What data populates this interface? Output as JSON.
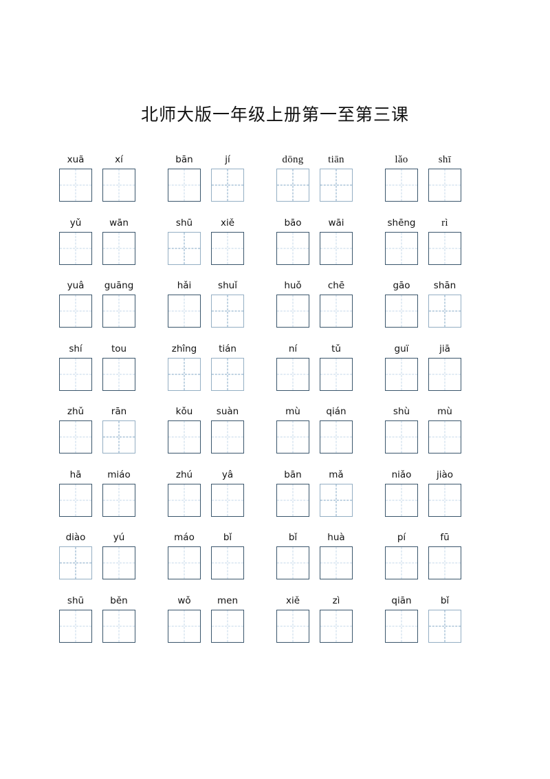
{
  "document": {
    "title": "北师大版一年级上册第一至第三课",
    "page_background": "#ffffff",
    "grid_border_color": "#39556b",
    "grid_guide_color": "#c3d7e8"
  },
  "worksheet": {
    "columns_per_row": 4,
    "cells_per_group": 2,
    "rows": [
      {
        "index": 1,
        "groups": [
          {
            "cells": [
              {
                "pinyin": "xuã",
                "style": "sans"
              },
              {
                "pinyin": "xí",
                "style": "sans"
              }
            ]
          },
          {
            "cells": [
              {
                "pinyin": "bān",
                "style": "sans"
              },
              {
                "pinyin": "jí",
                "style": "sans"
              }
            ]
          },
          {
            "cells": [
              {
                "pinyin": "dōng",
                "style": "serif"
              },
              {
                "pinyin": "tiān",
                "style": "serif"
              }
            ]
          },
          {
            "cells": [
              {
                "pinyin": "lǎo",
                "style": "serif"
              },
              {
                "pinyin": "shī",
                "style": "serif"
              }
            ]
          }
        ]
      },
      {
        "index": 2,
        "groups": [
          {
            "cells": [
              {
                "pinyin": "yǔ",
                "style": "sans"
              },
              {
                "pinyin": "wān",
                "style": "sans"
              }
            ]
          },
          {
            "cells": [
              {
                "pinyin": "shū",
                "style": "sans"
              },
              {
                "pinyin": "xiě",
                "style": "sans"
              }
            ]
          },
          {
            "cells": [
              {
                "pinyin": "bāo",
                "style": "sans"
              },
              {
                "pinyin": "wāi",
                "style": "sans"
              }
            ]
          },
          {
            "cells": [
              {
                "pinyin": "shēng",
                "style": "sans"
              },
              {
                "pinyin": "rì",
                "style": "serif"
              }
            ]
          }
        ]
      },
      {
        "index": 3,
        "groups": [
          {
            "cells": [
              {
                "pinyin": "yuâ",
                "style": "sans"
              },
              {
                "pinyin": "guāng",
                "style": "sans"
              }
            ]
          },
          {
            "cells": [
              {
                "pinyin": "hǎi",
                "style": "sans"
              },
              {
                "pinyin": "shuǐ",
                "style": "sans"
              }
            ]
          },
          {
            "cells": [
              {
                "pinyin": "huǒ",
                "style": "sans"
              },
              {
                "pinyin": "chē",
                "style": "sans"
              }
            ]
          },
          {
            "cells": [
              {
                "pinyin": "gāo",
                "style": "sans"
              },
              {
                "pinyin": "shān",
                "style": "sans"
              }
            ]
          }
        ]
      },
      {
        "index": 4,
        "groups": [
          {
            "cells": [
              {
                "pinyin": "shí",
                "style": "sans"
              },
              {
                "pinyin": "tou",
                "style": "sans"
              }
            ]
          },
          {
            "cells": [
              {
                "pinyin": "zhîng",
                "style": "sans"
              },
              {
                "pinyin": "tián",
                "style": "sans"
              }
            ]
          },
          {
            "cells": [
              {
                "pinyin": "ní",
                "style": "sans"
              },
              {
                "pinyin": "tǔ",
                "style": "sans"
              }
            ]
          },
          {
            "cells": [
              {
                "pinyin": "guï",
                "style": "sans"
              },
              {
                "pinyin": "jiā",
                "style": "sans"
              }
            ]
          }
        ]
      },
      {
        "index": 5,
        "groups": [
          {
            "cells": [
              {
                "pinyin": "zhǔ",
                "style": "sans"
              },
              {
                "pinyin": "rān",
                "style": "sans"
              }
            ]
          },
          {
            "cells": [
              {
                "pinyin": "kǒu",
                "style": "sans"
              },
              {
                "pinyin": "suàn",
                "style": "sans"
              }
            ]
          },
          {
            "cells": [
              {
                "pinyin": "mù",
                "style": "sans"
              },
              {
                "pinyin": "qián",
                "style": "sans"
              }
            ]
          },
          {
            "cells": [
              {
                "pinyin": "shù",
                "style": "sans"
              },
              {
                "pinyin": "mù",
                "style": "sans"
              }
            ]
          }
        ]
      },
      {
        "index": 6,
        "groups": [
          {
            "cells": [
              {
                "pinyin": "hā",
                "style": "sans"
              },
              {
                "pinyin": "miáo",
                "style": "sans"
              }
            ]
          },
          {
            "cells": [
              {
                "pinyin": "zhú",
                "style": "sans"
              },
              {
                "pinyin": "yâ",
                "style": "sans"
              }
            ]
          },
          {
            "cells": [
              {
                "pinyin": "bān",
                "style": "sans"
              },
              {
                "pinyin": "mǎ",
                "style": "sans"
              }
            ]
          },
          {
            "cells": [
              {
                "pinyin": "niǎo",
                "style": "sans"
              },
              {
                "pinyin": "jiào",
                "style": "sans"
              }
            ]
          }
        ]
      },
      {
        "index": 7,
        "groups": [
          {
            "cells": [
              {
                "pinyin": "diào",
                "style": "sans"
              },
              {
                "pinyin": "yú",
                "style": "sans"
              }
            ]
          },
          {
            "cells": [
              {
                "pinyin": "máo",
                "style": "sans"
              },
              {
                "pinyin": "bǐ",
                "style": "sans"
              }
            ]
          },
          {
            "cells": [
              {
                "pinyin": "bǐ",
                "style": "sans"
              },
              {
                "pinyin": "huà",
                "style": "sans"
              }
            ]
          },
          {
            "cells": [
              {
                "pinyin": "pí",
                "style": "sans"
              },
              {
                "pinyin": "fū",
                "style": "sans"
              }
            ]
          }
        ]
      },
      {
        "index": 8,
        "groups": [
          {
            "cells": [
              {
                "pinyin": "shū",
                "style": "sans"
              },
              {
                "pinyin": "běn",
                "style": "sans"
              }
            ]
          },
          {
            "cells": [
              {
                "pinyin": "wǒ",
                "style": "sans"
              },
              {
                "pinyin": "men",
                "style": "sans"
              }
            ]
          },
          {
            "cells": [
              {
                "pinyin": "xiě",
                "style": "sans"
              },
              {
                "pinyin": "zì",
                "style": "sans"
              }
            ]
          },
          {
            "cells": [
              {
                "pinyin": "qiān",
                "style": "sans"
              },
              {
                "pinyin": "bǐ",
                "style": "sans"
              }
            ]
          }
        ]
      }
    ]
  }
}
